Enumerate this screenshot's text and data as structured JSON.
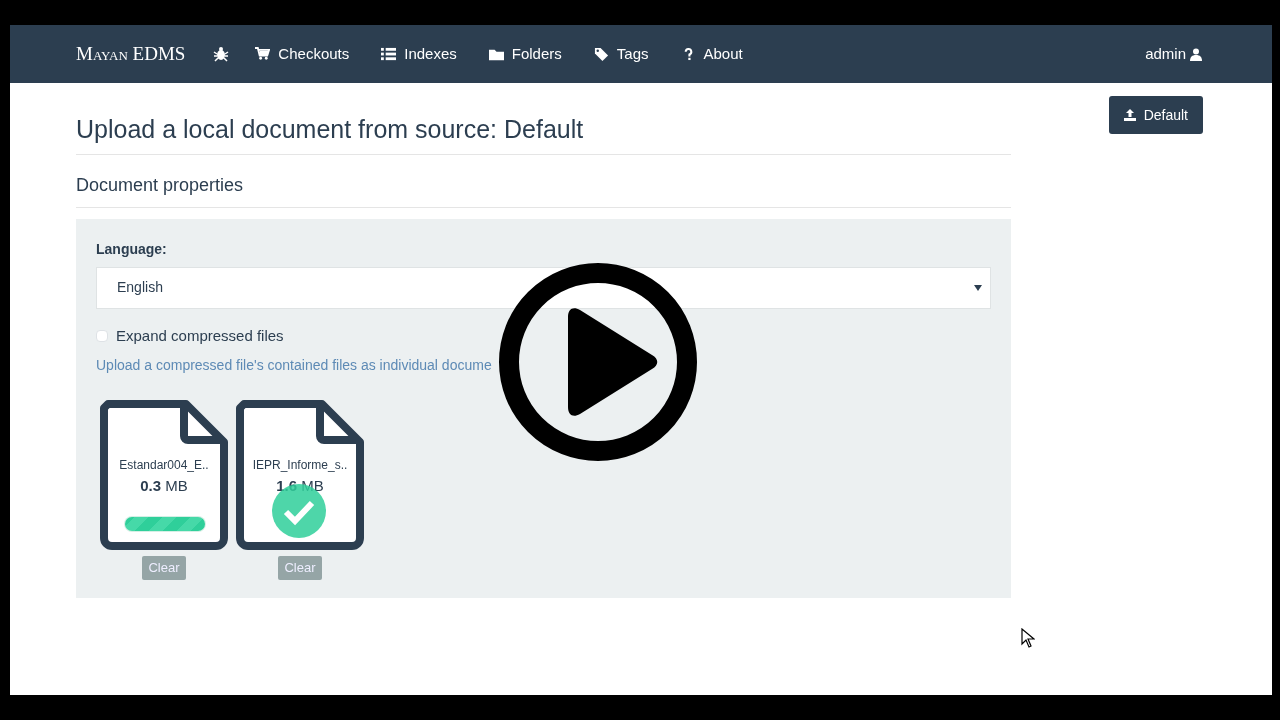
{
  "navbar": {
    "brand": "Mayan EDMS",
    "items": [
      {
        "label": "Checkouts"
      },
      {
        "label": "Indexes"
      },
      {
        "label": "Folders"
      },
      {
        "label": "Tags"
      },
      {
        "label": "About"
      }
    ],
    "user": "admin"
  },
  "source_button": "Default",
  "title": "Upload a local document from source: Default",
  "section": "Document properties",
  "form": {
    "language_label": "Language:",
    "language_value": "English",
    "expand": {
      "label": "Expand compressed files",
      "checked": false
    },
    "help": "Upload a compressed file's contained files as individual docume"
  },
  "files": [
    {
      "name": "Estandar004_E..",
      "size_value": "0.3",
      "size_unit": "MB",
      "kind": "progress",
      "level": 1.0,
      "clear": "Clear"
    },
    {
      "name": "IEPR_Informe_s..",
      "size_value": "1.6",
      "size_unit": "MB",
      "kind": "success",
      "clear": "Clear"
    }
  ]
}
